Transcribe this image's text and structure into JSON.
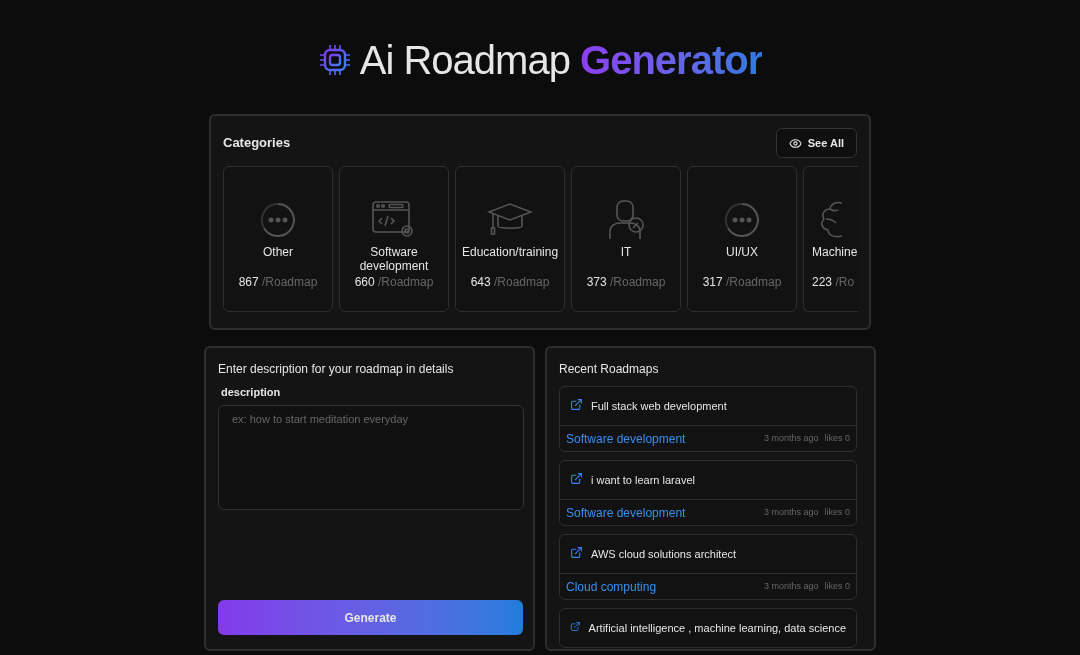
{
  "header": {
    "title": "Ai Roadmap",
    "title_highlight": "Generator"
  },
  "categories": {
    "heading": "Categories",
    "see_all": "See All",
    "items": [
      {
        "kind": "dots",
        "name": "Other",
        "count": "867",
        "unit": "/Roadmap",
        "partial": false
      },
      {
        "kind": "code",
        "name": "Software development",
        "count": "660",
        "unit": "/Roadmap",
        "partial": false
      },
      {
        "kind": "cap",
        "name": "Education/training",
        "count": "643",
        "unit": "/Roadmap",
        "partial": false
      },
      {
        "kind": "person",
        "name": "IT",
        "count": "373",
        "unit": "/Roadmap",
        "partial": false
      },
      {
        "kind": "dots",
        "name": "UI/UX",
        "count": "317",
        "unit": "/Roadmap",
        "partial": false
      },
      {
        "kind": "brain",
        "name": "Machine",
        "count": "223",
        "unit": "/Ro",
        "partial": true
      }
    ]
  },
  "form": {
    "heading": "Enter description for your roadmap in details",
    "label": "description",
    "placeholder": "ex: how to start meditation everyday",
    "button": "Generate"
  },
  "recent": {
    "heading": "Recent Roadmaps",
    "items": [
      {
        "title": "Full stack web development",
        "category": "Software development",
        "time": "3 months ago",
        "likes": "likes 0"
      },
      {
        "title": "i want to learn laravel",
        "category": "Software development",
        "time": "3 months ago",
        "likes": "likes 0"
      },
      {
        "title": "AWS cloud solutions architect",
        "category": "Cloud computing",
        "time": "3 months ago",
        "likes": "likes 0"
      },
      {
        "title": "Artificial intelligence , machine learning, data science"
      }
    ]
  }
}
